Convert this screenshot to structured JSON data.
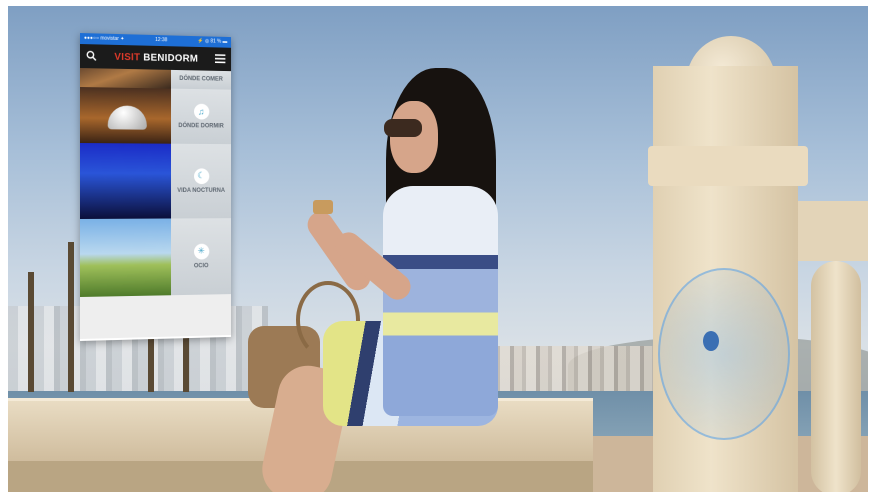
{
  "app": {
    "status_left": "●●●○○ movistar ✦",
    "status_time": "12:38",
    "status_right": "⚡ ◎ 81 % ▬",
    "brand_visit": "VISIT",
    "brand_name": "BENIDORM",
    "menu": [
      {
        "label": "DÓNDE COMER",
        "icon": ""
      },
      {
        "label": "DÓNDE DORMIR",
        "icon": "♫"
      },
      {
        "label": "VIDA NOCTURNA",
        "icon": "☾"
      },
      {
        "label": "OCIO",
        "icon": "✳"
      }
    ]
  },
  "icons": {
    "search": "search-icon",
    "menu": "hamburger-menu-icon"
  },
  "colors": {
    "status_bar": "#1e6fd6",
    "brand_accent": "#e03a2a",
    "nav_bar": "#1b1b1b",
    "beacon": "#3b6fb3"
  }
}
